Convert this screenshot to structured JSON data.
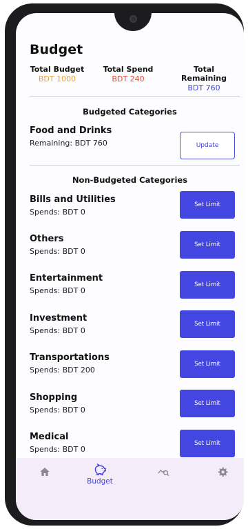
{
  "header": {
    "title": "Budget"
  },
  "summary": [
    {
      "label": "Total Budget",
      "value": "BDT 1000",
      "color": "#e8a33d"
    },
    {
      "label": "Total Spend",
      "value": "BDT 240",
      "color": "#e5493a"
    },
    {
      "label": "Total Remaining",
      "value": "BDT 760",
      "color": "#4346e0"
    }
  ],
  "budgeted": {
    "title": "Budgeted Categories",
    "items": [
      {
        "name": "Food and Drinks",
        "sub": "Remaining: BDT 760",
        "button": "Update"
      }
    ]
  },
  "non_budgeted": {
    "title": "Non-Budgeted Categories",
    "items": [
      {
        "name": "Bills and Utilities",
        "sub": "Spends: BDT 0",
        "button": "Set Limit"
      },
      {
        "name": "Others",
        "sub": "Spends: BDT 0",
        "button": "Set Limit"
      },
      {
        "name": "Entertainment",
        "sub": "Spends: BDT 0",
        "button": "Set Limit"
      },
      {
        "name": "Investment",
        "sub": "Spends: BDT 0",
        "button": "Set Limit"
      },
      {
        "name": "Transportations",
        "sub": "Spends: BDT 200",
        "button": "Set Limit"
      },
      {
        "name": "Shopping",
        "sub": "Spends: BDT 0",
        "button": "Set Limit"
      },
      {
        "name": "Medical",
        "sub": "Spends: BDT 0",
        "button": "Set Limit"
      }
    ]
  },
  "nav": {
    "items": [
      {
        "icon": "home-icon",
        "label": ""
      },
      {
        "icon": "piggy-bank-icon",
        "label": "Budget",
        "active": true
      },
      {
        "icon": "chart-search-icon",
        "label": ""
      },
      {
        "icon": "gear-icon",
        "label": ""
      }
    ]
  }
}
